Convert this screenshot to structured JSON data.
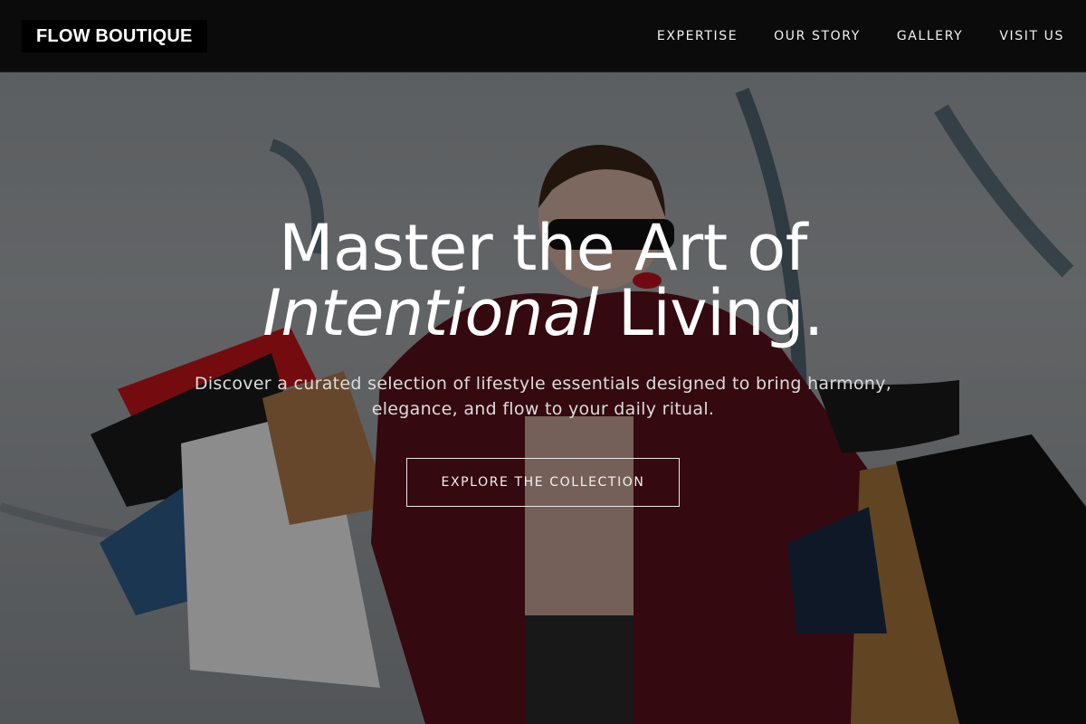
{
  "brand": {
    "name": "FLOW BOUTIQUE"
  },
  "nav": {
    "links": [
      "EXPERTISE",
      "OUR STORY",
      "GALLERY",
      "VISIT US"
    ]
  },
  "hero": {
    "headline_line1": "Master the Art of",
    "headline_italic": "Intentional",
    "headline_tail": " Living.",
    "subtitle": "Discover a curated selection of lifestyle essentials designed to bring harmony, elegance, and flow to your daily ritual.",
    "cta_label": "EXPLORE THE COLLECTION",
    "background_image": "woman-with-shopping-bags-photo"
  },
  "colors": {
    "navbar_bg": "#0b0b0b",
    "text_primary": "#ffffff",
    "text_muted": "#dcdcdc",
    "coat_red": "#6b1620"
  }
}
